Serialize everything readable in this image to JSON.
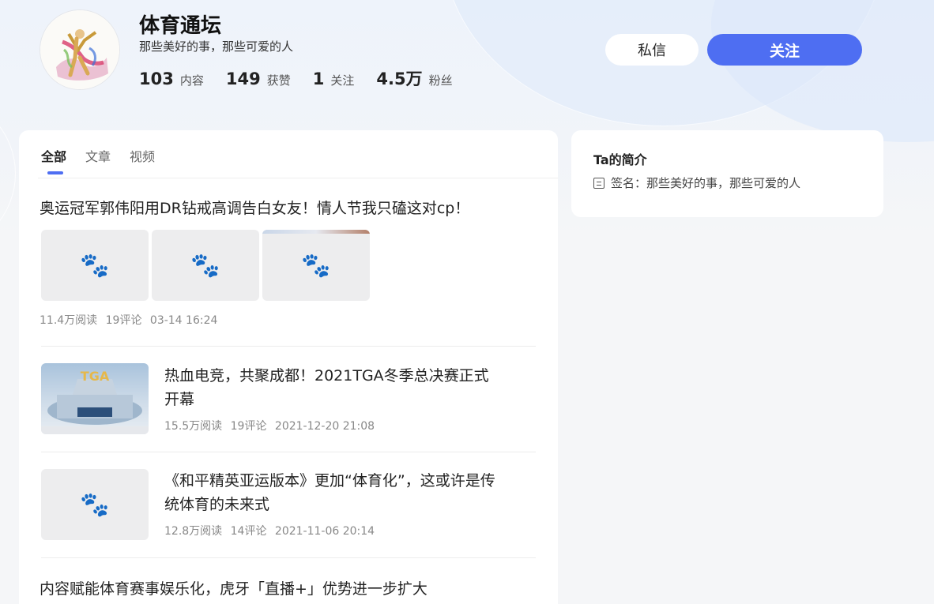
{
  "profile": {
    "name": "体育通坛",
    "signature": "那些美好的事，那些可爱的人",
    "stats": [
      {
        "num": "103",
        "label": "内容"
      },
      {
        "num": "149",
        "label": "获赞"
      },
      {
        "num": "1",
        "label": "关注"
      },
      {
        "num": "4.5万",
        "label": "粉丝"
      }
    ]
  },
  "actions": {
    "message_label": "私信",
    "follow_label": "关注"
  },
  "tabs": [
    {
      "label": "全部",
      "active": true
    },
    {
      "label": "文章",
      "active": false
    },
    {
      "label": "视频",
      "active": false
    }
  ],
  "feed": [
    {
      "title": "奥运冠军郭伟阳用DR钻戒高调告白女友！情人节我只磕这对cp！",
      "reads": "11.4万阅读",
      "comments": "19评论",
      "time": "03-14 16:24"
    },
    {
      "title": "热血电竞，共聚成都！2021TGA冬季总决赛正式开幕",
      "reads": "15.5万阅读",
      "comments": "19评论",
      "time": "2021-12-20 21:08"
    },
    {
      "title": "《和平精英亚运版本》更加“体育化”，这或许是传统体育的未来式",
      "reads": "12.8万阅读",
      "comments": "14评论",
      "time": "2021-11-06 20:14"
    },
    {
      "title": "内容赋能体育赛事娱乐化，虎牙「直播+」优势进一步扩大"
    }
  ],
  "sidebar": {
    "title": "Ta的简介",
    "signature": "签名：那些美好的事，那些可爱的人"
  },
  "icons": {
    "thumb_placeholder": "paw-icon",
    "signature": "document-icon"
  }
}
